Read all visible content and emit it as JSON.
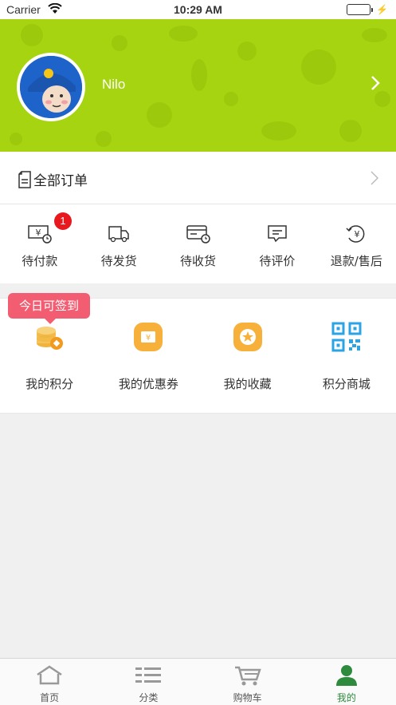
{
  "status_bar": {
    "carrier": "Carrier",
    "time": "10:29 AM"
  },
  "profile": {
    "username": "Nilo"
  },
  "orders": {
    "title": "全部订单"
  },
  "order_status": [
    {
      "label": "待付款",
      "badge": "1",
      "icon": "yuan-bill-icon"
    },
    {
      "label": "待发货",
      "icon": "delivery-truck-icon"
    },
    {
      "label": "待收货",
      "icon": "card-clock-icon"
    },
    {
      "label": "待评价",
      "icon": "comment-icon"
    },
    {
      "label": "退款/售后",
      "icon": "refund-icon"
    }
  ],
  "signin_tip": "今日可签到",
  "services": [
    {
      "label": "我的积分",
      "icon": "coins-icon"
    },
    {
      "label": "我的优惠券",
      "icon": "coupon-icon"
    },
    {
      "label": "我的收藏",
      "icon": "star-icon"
    },
    {
      "label": "积分商城",
      "icon": "qr-code-icon"
    }
  ],
  "tabbar": [
    {
      "label": "首页",
      "icon": "home-icon"
    },
    {
      "label": "分类",
      "icon": "category-list-icon"
    },
    {
      "label": "购物车",
      "icon": "cart-icon"
    },
    {
      "label": "我的",
      "icon": "user-icon",
      "active": true
    }
  ],
  "colors": {
    "brand_green": "#a6d410",
    "accent": "#2e8b3e",
    "badge_red": "#e8181f",
    "tip_pink": "#f35d72"
  }
}
